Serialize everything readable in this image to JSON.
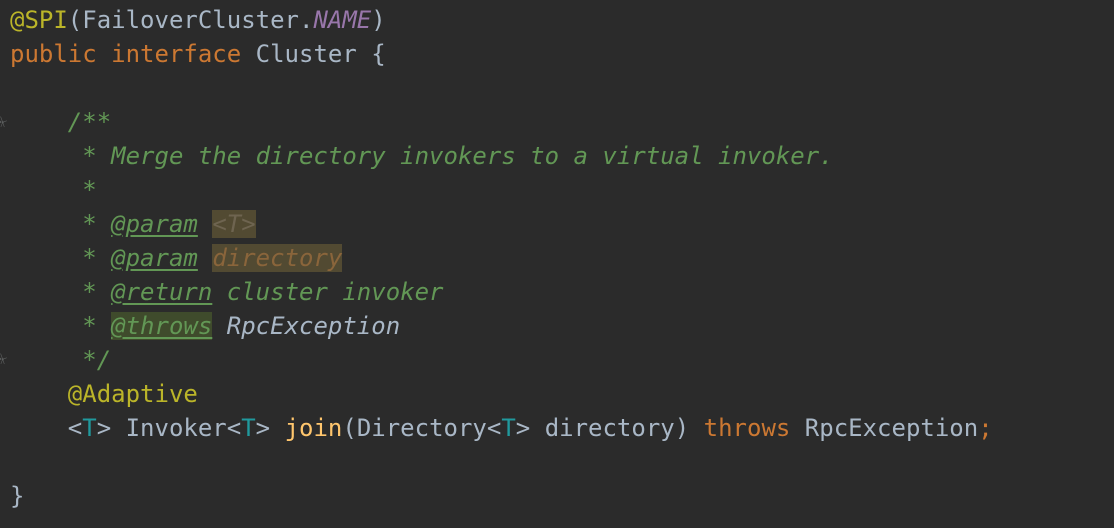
{
  "code": {
    "line1": {
      "annotation": "@SPI",
      "open": "(",
      "class_ref": "FailoverCluster.",
      "const_ref": "NAME",
      "close": ")"
    },
    "line2": {
      "kw1": "public",
      "kw2": "interface",
      "name": "Cluster",
      "brace": "{"
    },
    "doc": {
      "open": "/**",
      "line1": " * Merge the directory invokers to a virtual invoker.",
      "line2": " *",
      "param_prefix1": " * ",
      "param_tag1": "@param",
      "param_value1": "<T>",
      "param_prefix2": " * ",
      "param_tag2": "@param",
      "param_value2": "directory",
      "return_prefix": " * ",
      "return_tag": "@return",
      "return_value": "cluster invoker",
      "throws_prefix": " * ",
      "throws_tag": "@throws",
      "throws_value": "RpcException",
      "close": " */"
    },
    "annotation2": "@Adaptive",
    "signature": {
      "tp_open": "<",
      "tp": "T",
      "tp_close": ">",
      "return_type": "Invoker",
      "rt_open": "<",
      "rt_tp": "T",
      "rt_close": ">",
      "method": "join",
      "paren_open": "(",
      "param_type": "Directory",
      "pt_open": "<",
      "pt_tp": "T",
      "pt_close": ">",
      "param_name": "directory",
      "paren_close": ")",
      "throws_kw": "throws",
      "exception": "RpcException",
      "semicolon": ";"
    },
    "closing_brace": "}"
  },
  "colors": {
    "background": "#2b2b2b",
    "annotation": "#bbb529",
    "keyword": "#cc7832",
    "constant": "#9876aa",
    "default_text": "#a9b7c6",
    "type_parameter": "#20999d",
    "method": "#ffc66d",
    "doc_comment": "#629755"
  }
}
